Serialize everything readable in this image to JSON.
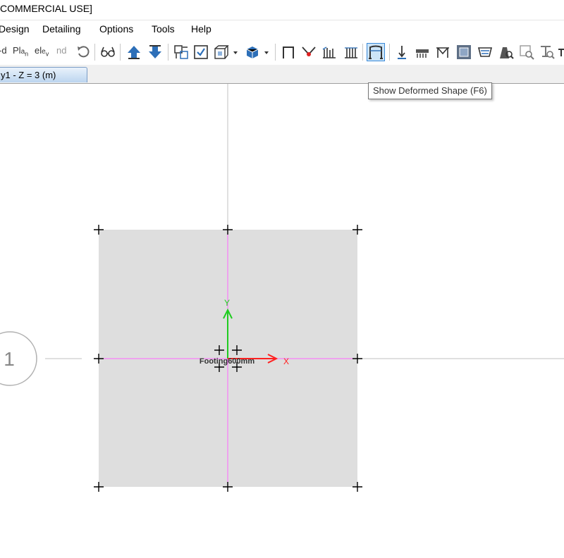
{
  "window": {
    "title": "COMMERCIAL USE]"
  },
  "menu": [
    "Design",
    "Detailing",
    "Options",
    "Tools",
    "Help"
  ],
  "toolbar": {
    "text_buttons": [
      "-d",
      "Pl&#770;n",
      "elév",
      "nd"
    ],
    "tooltip": "Show  Deformed Shape (F6)"
  },
  "tab": {
    "label": "y1 - Z = 3 (m)"
  },
  "canvas": {
    "grid_bubble_label": "1",
    "footing_label": "Footing600mm",
    "axis_x_label": "X",
    "axis_y_label": "Y"
  },
  "colors": {
    "slab_fill": "#dedede",
    "grid_line": "#c0c0c0",
    "magenta_line": "#ff66ff",
    "axis_x": "#ff2020",
    "axis_y": "#20cc20",
    "active_button": "#cce4f7"
  }
}
